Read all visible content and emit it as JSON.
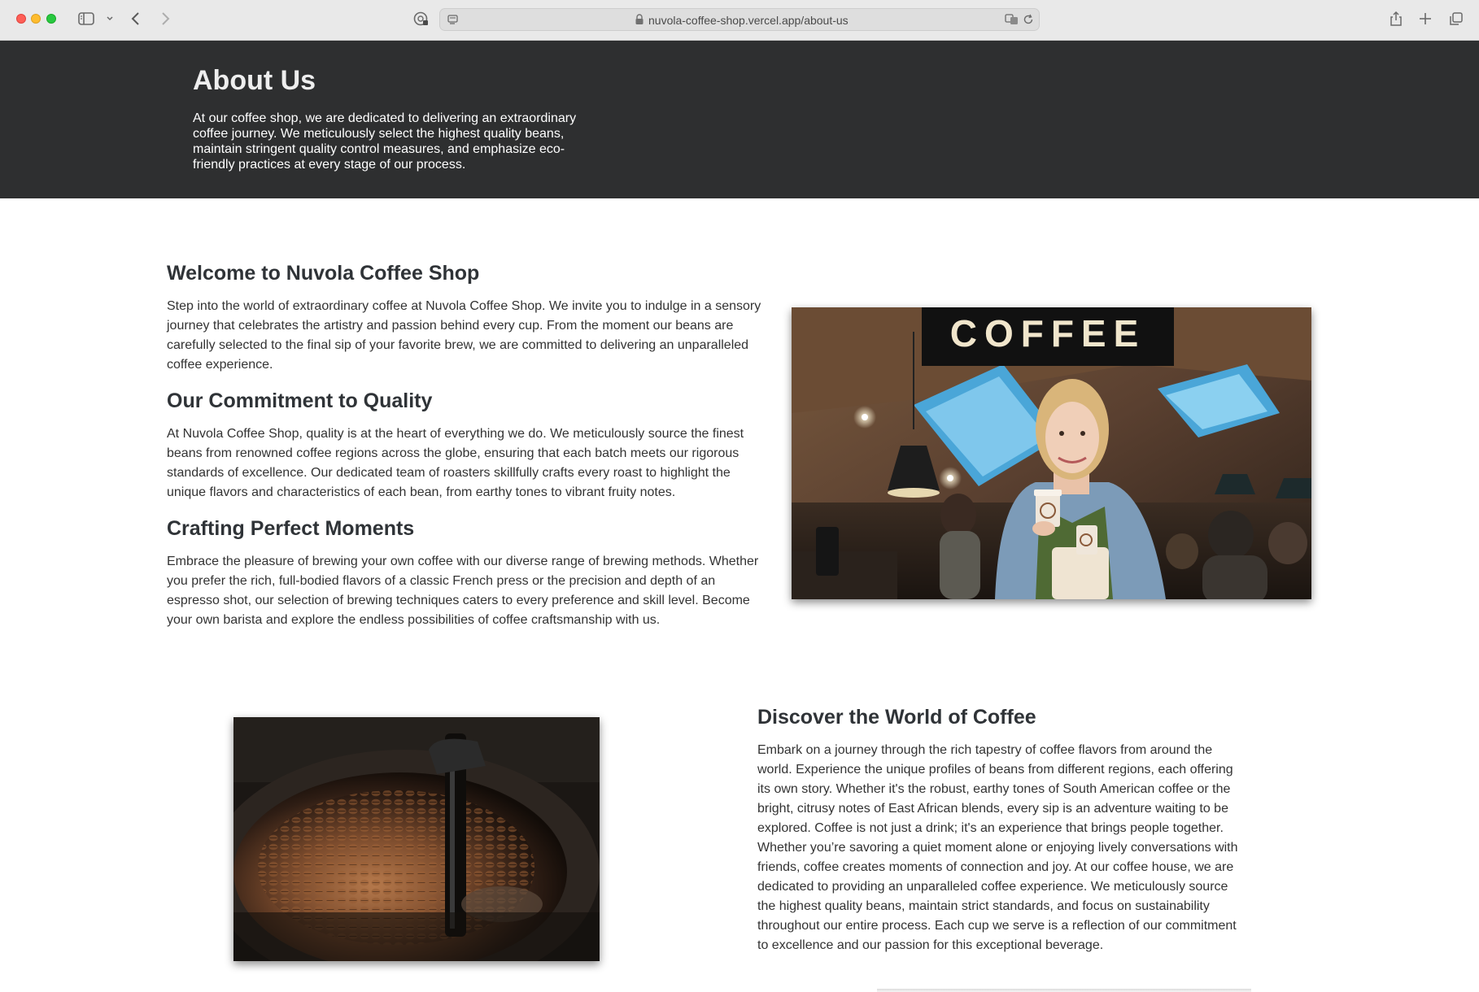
{
  "browser": {
    "url": "nuvola-coffee-shop.vercel.app/about-us"
  },
  "hero": {
    "title": "About Us",
    "text": "At our coffee shop, we are dedicated to delivering an extraordinary coffee journey. We meticulously select the highest quality beans, maintain stringent quality control measures, and emphasize eco-friendly practices at every stage of our process."
  },
  "section1": {
    "welcome_title": "Welcome to Nuvola Coffee Shop",
    "welcome_text": "Step into the world of extraordinary coffee at Nuvola Coffee Shop. We invite you to indulge in a sensory journey that celebrates the artistry and passion behind every cup. From the moment our beans are carefully selected to the final sip of your favorite brew, we are committed to delivering an unparalleled coffee experience.",
    "quality_title": "Our Commitment to Quality",
    "quality_text": "At Nuvola Coffee Shop, quality is at the heart of everything we do. We meticulously source the finest beans from renowned coffee regions across the globe, ensuring that each batch meets our rigorous standards of excellence. Our dedicated team of roasters skillfully crafts every roast to highlight the unique flavors and characteristics of each bean, from earthy tones to vibrant fruity notes.",
    "moments_title": "Crafting Perfect Moments",
    "moments_text": "Embrace the pleasure of brewing your own coffee with our diverse range of brewing methods. Whether you prefer the rich, full-bodied flavors of a classic French press or the precision and depth of an espresso shot, our selection of brewing techniques caters to every preference and skill level. Become your own barista and explore the endless possibilities of coffee craftsmanship with us.",
    "image_sign_text": "COFFEE"
  },
  "section2": {
    "title": "Discover the World of Coffee",
    "text": "Embark on a journey through the rich tapestry of coffee flavors from around the world. Experience the unique profiles of beans from different regions, each offering its own story. Whether it's the robust, earthy tones of South American coffee or the bright, citrusy notes of East African blends, every sip is an adventure waiting to be explored. Coffee is not just a drink; it's an experience that brings people together. Whether you’re savoring a quiet moment alone or enjoying lively conversations with friends, coffee creates moments of connection and joy. At our coffee house, we are dedicated to providing an unparalleled coffee experience. We meticulously source the highest quality beans, maintain strict standards, and focus on sustainability throughout our entire process. Each cup we serve is a reflection of our commitment to excellence and our passion for this exceptional beverage."
  },
  "icons": [
    "sidebar-icon",
    "chevron-down-icon",
    "back-icon",
    "forward-icon",
    "privacy-icon",
    "site-settings-icon",
    "lock-icon",
    "translate-icon",
    "reload-icon",
    "share-icon",
    "new-tab-icon",
    "tab-overview-icon"
  ]
}
